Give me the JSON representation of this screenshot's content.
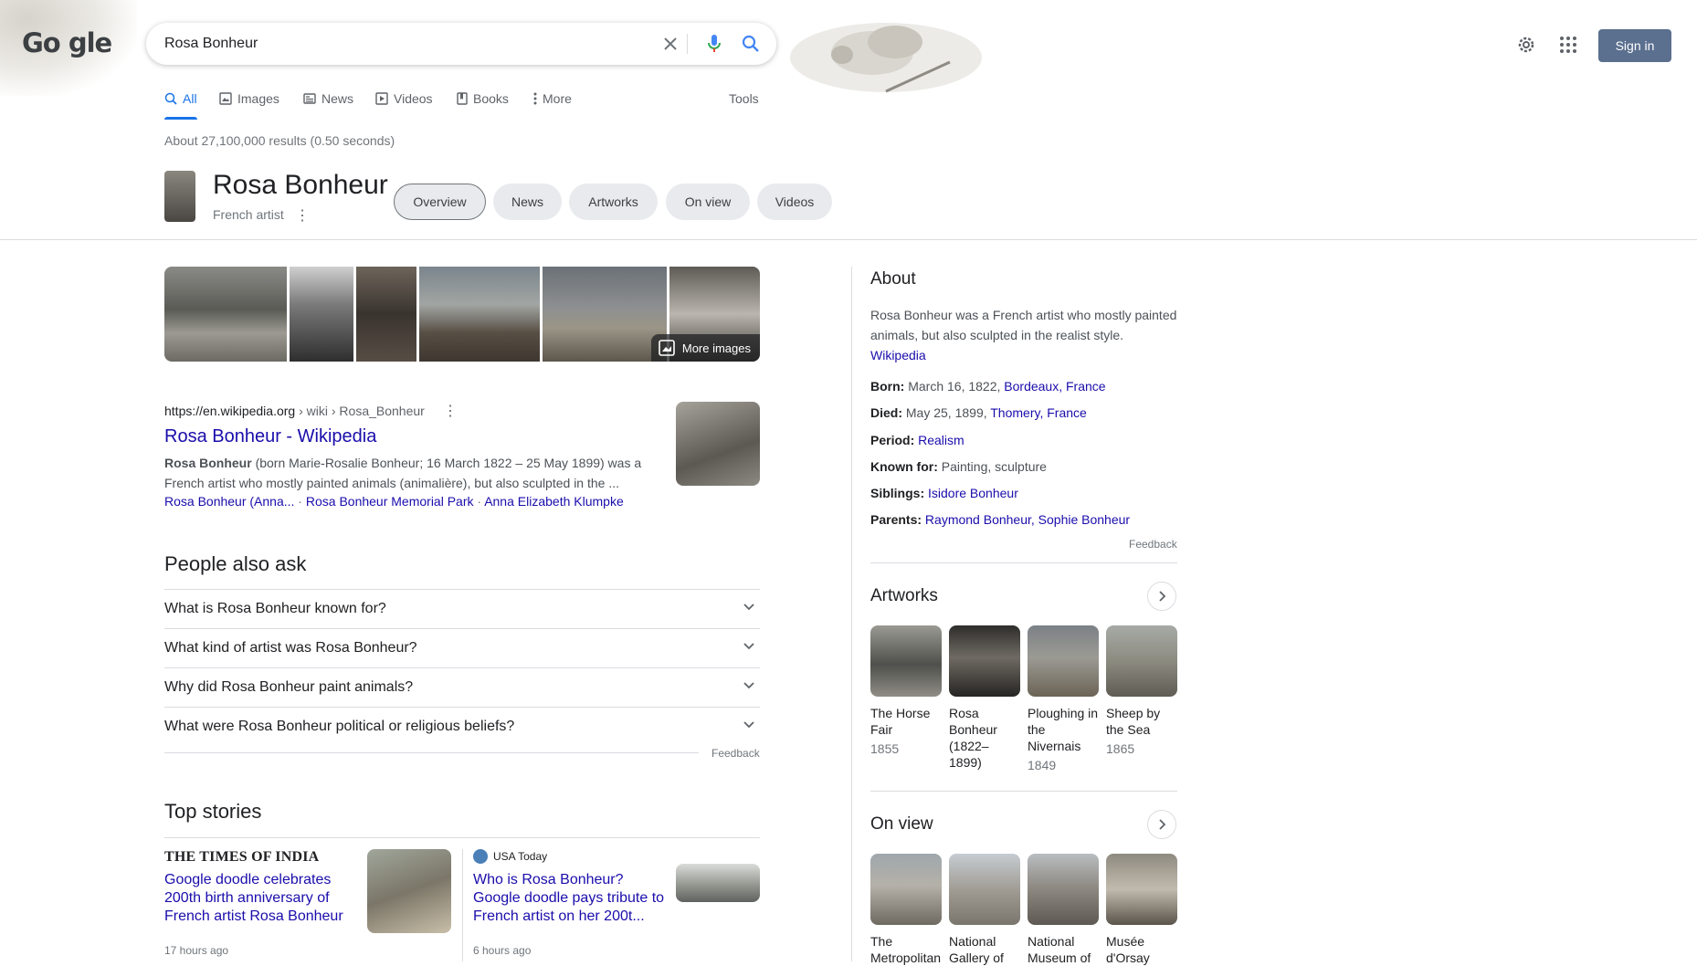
{
  "header": {
    "logo_text": "Go gle",
    "search_query": "Rosa Bonheur",
    "sign_in_label": "Sign in"
  },
  "tabs": [
    {
      "label": "All",
      "icon": "search-icon",
      "active": true
    },
    {
      "label": "Images",
      "icon": "image-icon"
    },
    {
      "label": "News",
      "icon": "news-icon"
    },
    {
      "label": "Videos",
      "icon": "video-icon"
    },
    {
      "label": "Books",
      "icon": "book-icon"
    },
    {
      "label": "More",
      "icon": "more-vert-icon"
    }
  ],
  "tools_label": "Tools",
  "results_count": "About 27,100,000 results (0.50 seconds)",
  "entity": {
    "title": "Rosa Bonheur",
    "subtitle": "French artist",
    "chips": [
      "Overview",
      "News",
      "Artworks",
      "On view",
      "Videos"
    ]
  },
  "images": {
    "more_label": "More images"
  },
  "result": {
    "url_host": "https://en.wikipedia.org",
    "url_path": " › wiki › Rosa_Bonheur",
    "title": "Rosa Bonheur - Wikipedia",
    "snippet_bold": "Rosa Bonheur",
    "snippet_rest": " (born Marie-Rosalie Bonheur; 16 March 1822 – 25 May 1899) was a French artist who mostly painted animals (animalière), but also sculpted in the ...",
    "sitelinks": [
      "Rosa Bonheur (Anna...",
      "Rosa Bonheur Memorial Park",
      "Anna Elizabeth Klumpke"
    ]
  },
  "paa": {
    "title": "People also ask",
    "questions": [
      "What is Rosa Bonheur known for?",
      "What kind of artist was Rosa Bonheur?",
      "Why did Rosa Bonheur paint animals?",
      "What were Rosa Bonheur political or religious beliefs?"
    ],
    "feedback": "Feedback"
  },
  "top_stories": {
    "title": "Top stories",
    "stories": [
      {
        "source": "THE TIMES OF INDIA",
        "headline": "Google doodle celebrates 200th birth anniversary of French artist Rosa Bonheur",
        "time": "17 hours ago"
      },
      {
        "source": "USA Today",
        "headline": "Who is Rosa Bonheur? Google doodle pays tribute to French artist on her 200t...",
        "time": "6 hours ago"
      }
    ]
  },
  "knowledge_panel": {
    "about_title": "About",
    "about_text": "Rosa Bonheur was a French artist who mostly painted animals, but also sculpted in the realist style.",
    "about_source": "Wikipedia",
    "facts": [
      {
        "label": "Born:",
        "plain": " March 16, 1822, ",
        "link": "Bordeaux, France"
      },
      {
        "label": "Died:",
        "plain": " May 25, 1899, ",
        "link": "Thomery, France"
      },
      {
        "label": "Period:",
        "plain": " ",
        "link": "Realism"
      },
      {
        "label": "Known for:",
        "plain": " Painting, sculpture",
        "link": ""
      },
      {
        "label": "Siblings:",
        "plain": " ",
        "link": "Isidore Bonheur"
      },
      {
        "label": "Parents:",
        "plain": " ",
        "link": "Raymond Bonheur, Sophie Bonheur"
      }
    ],
    "feedback": "Feedback",
    "artworks_title": "Artworks",
    "artworks": [
      {
        "name": "The Horse Fair",
        "year": "1855"
      },
      {
        "name": "Rosa Bonheur (1822–1899)",
        "year": ""
      },
      {
        "name": "Ploughing in the Nivernais",
        "year": "1849"
      },
      {
        "name": "Sheep by the Sea",
        "year": "1865"
      }
    ],
    "onview_title": "On view",
    "onview": [
      {
        "name": "The Metropolitan"
      },
      {
        "name": "National Gallery of"
      },
      {
        "name": "National Museum of"
      },
      {
        "name": "Musée d'Orsay"
      }
    ]
  }
}
